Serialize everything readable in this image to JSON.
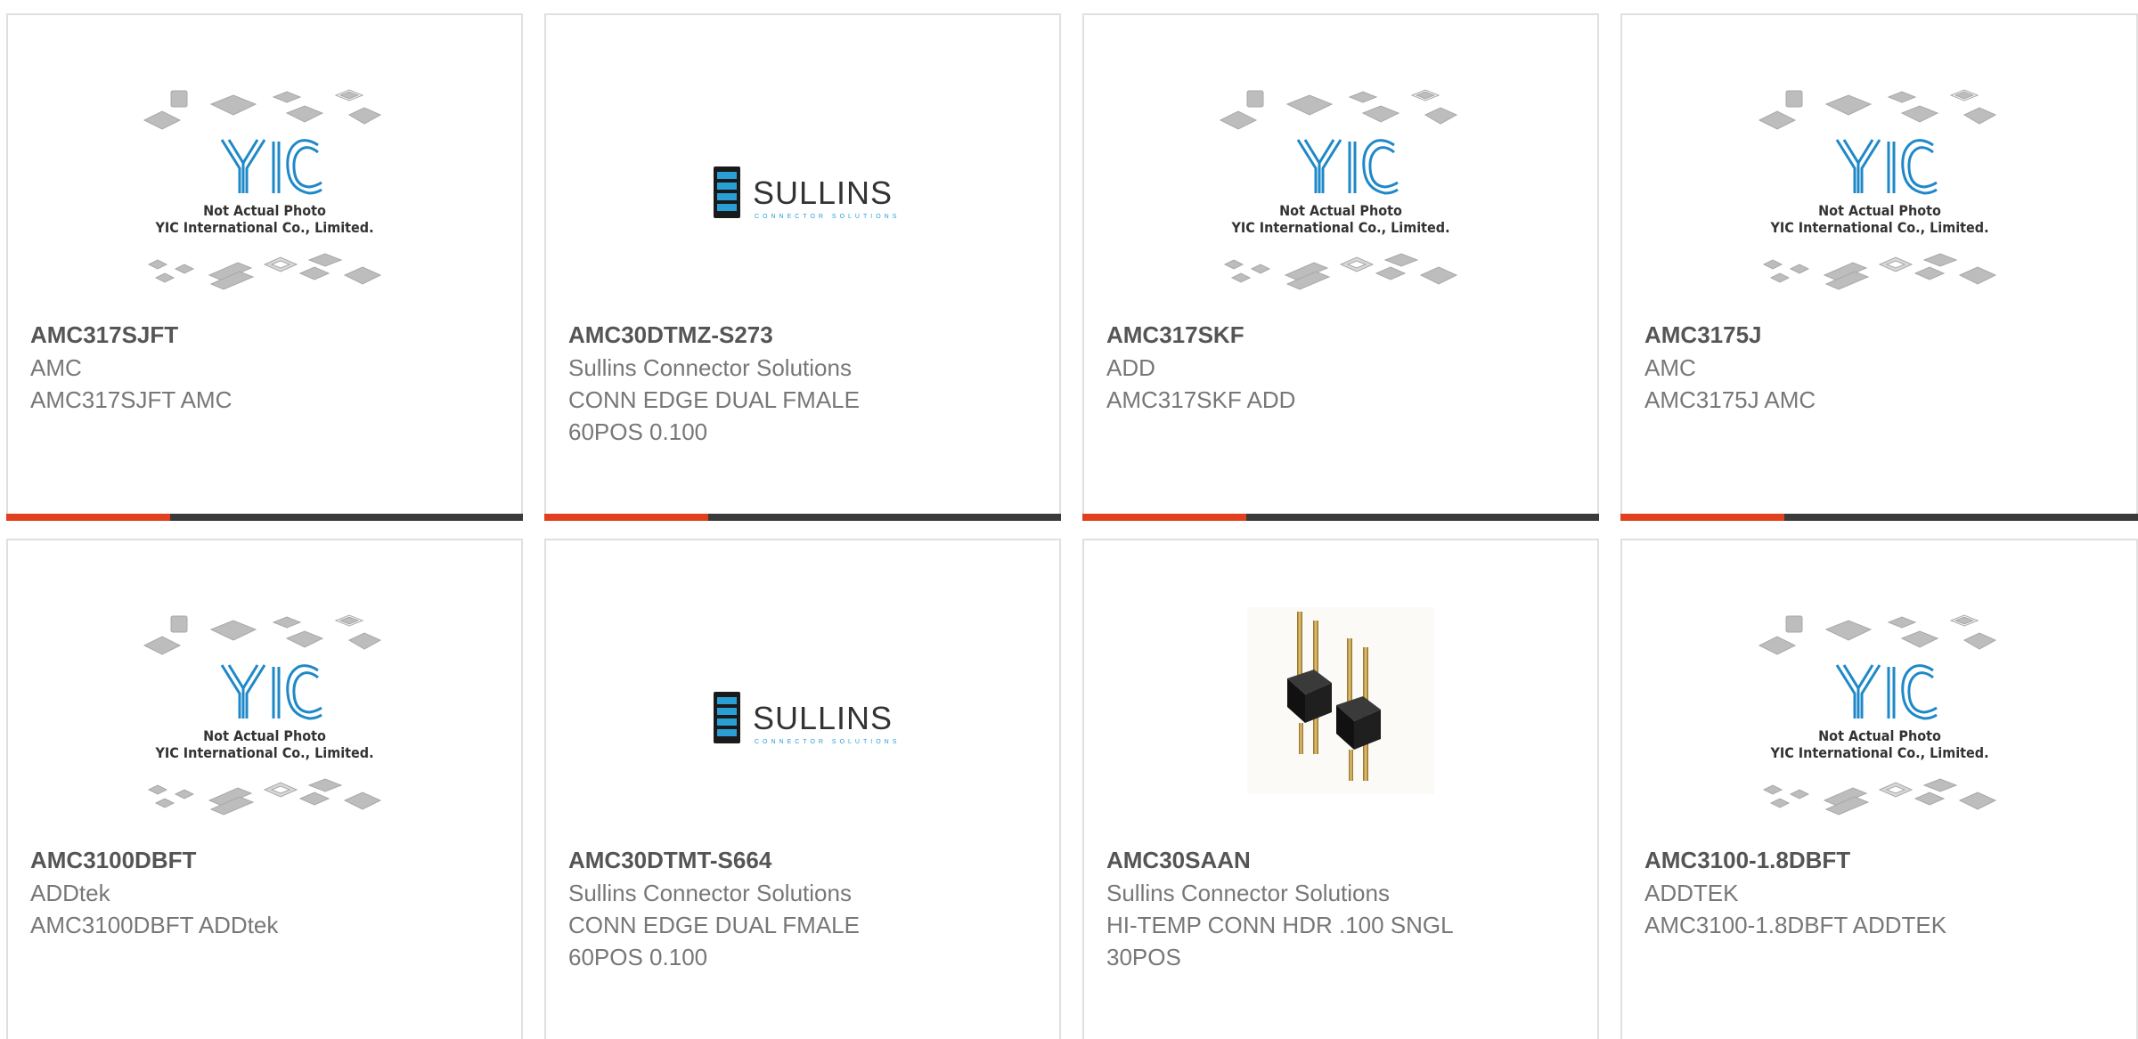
{
  "products": [
    {
      "part": "AMC317SJFT",
      "mfr": "AMC",
      "desc": "AMC317SJFT AMC",
      "desc2": "",
      "image": "yic-placeholder"
    },
    {
      "part": "AMC30DTMZ-S273",
      "mfr": "Sullins Connector Solutions",
      "desc": "CONN EDGE DUAL FMALE",
      "desc2": "60POS 0.100",
      "image": "sullins-logo"
    },
    {
      "part": "AMC317SKF",
      "mfr": "ADD",
      "desc": "AMC317SKF ADD",
      "desc2": "",
      "image": "yic-placeholder"
    },
    {
      "part": "AMC3175J",
      "mfr": "AMC",
      "desc": "AMC3175J AMC",
      "desc2": "",
      "image": "yic-placeholder"
    },
    {
      "part": "AMC3100DBFT",
      "mfr": "ADDtek",
      "desc": "AMC3100DBFT ADDtek",
      "desc2": "",
      "image": "yic-placeholder"
    },
    {
      "part": "AMC30DTMT-S664",
      "mfr": "Sullins Connector Solutions",
      "desc": "CONN EDGE DUAL FMALE",
      "desc2": "60POS 0.100",
      "image": "sullins-logo"
    },
    {
      "part": "AMC30SAAN",
      "mfr": "Sullins Connector Solutions",
      "desc": "HI-TEMP CONN HDR .100 SNGL",
      "desc2": "30POS",
      "image": "pin-header-photo"
    },
    {
      "part": "AMC3100-1.8DBFT",
      "mfr": "ADDTEK",
      "desc": "AMC3100-1.8DBFT ADDTEK",
      "desc2": "",
      "image": "yic-placeholder"
    }
  ],
  "placeholder": {
    "logo_text": "YIC",
    "line1": "Not Actual Photo",
    "line2": "YIC International Co., Limited."
  },
  "sullins": {
    "name": "SULLINS",
    "tagline": "CONNECTOR SOLUTIONS"
  },
  "colors": {
    "accent": "#e0401d",
    "bar": "#3a3a3a",
    "border": "#e0e0e0",
    "yic_blue": "#1e88c8",
    "sullins_blue": "#2a9fd6"
  }
}
